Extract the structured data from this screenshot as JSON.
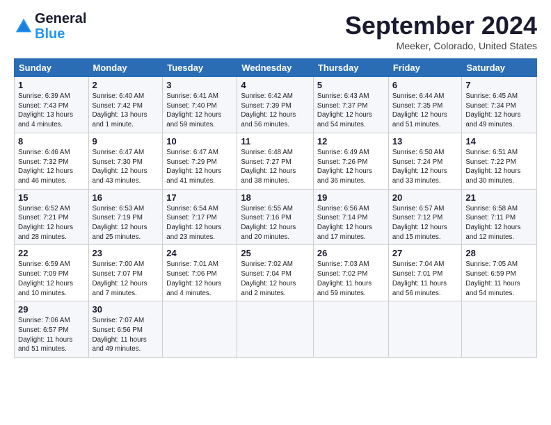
{
  "header": {
    "logo_line1": "General",
    "logo_line2": "Blue",
    "month": "September 2024",
    "location": "Meeker, Colorado, United States"
  },
  "weekdays": [
    "Sunday",
    "Monday",
    "Tuesday",
    "Wednesday",
    "Thursday",
    "Friday",
    "Saturday"
  ],
  "weeks": [
    [
      {
        "day": "1",
        "info": "Sunrise: 6:39 AM\nSunset: 7:43 PM\nDaylight: 13 hours\nand 4 minutes."
      },
      {
        "day": "2",
        "info": "Sunrise: 6:40 AM\nSunset: 7:42 PM\nDaylight: 13 hours\nand 1 minute."
      },
      {
        "day": "3",
        "info": "Sunrise: 6:41 AM\nSunset: 7:40 PM\nDaylight: 12 hours\nand 59 minutes."
      },
      {
        "day": "4",
        "info": "Sunrise: 6:42 AM\nSunset: 7:39 PM\nDaylight: 12 hours\nand 56 minutes."
      },
      {
        "day": "5",
        "info": "Sunrise: 6:43 AM\nSunset: 7:37 PM\nDaylight: 12 hours\nand 54 minutes."
      },
      {
        "day": "6",
        "info": "Sunrise: 6:44 AM\nSunset: 7:35 PM\nDaylight: 12 hours\nand 51 minutes."
      },
      {
        "day": "7",
        "info": "Sunrise: 6:45 AM\nSunset: 7:34 PM\nDaylight: 12 hours\nand 49 minutes."
      }
    ],
    [
      {
        "day": "8",
        "info": "Sunrise: 6:46 AM\nSunset: 7:32 PM\nDaylight: 12 hours\nand 46 minutes."
      },
      {
        "day": "9",
        "info": "Sunrise: 6:47 AM\nSunset: 7:30 PM\nDaylight: 12 hours\nand 43 minutes."
      },
      {
        "day": "10",
        "info": "Sunrise: 6:47 AM\nSunset: 7:29 PM\nDaylight: 12 hours\nand 41 minutes."
      },
      {
        "day": "11",
        "info": "Sunrise: 6:48 AM\nSunset: 7:27 PM\nDaylight: 12 hours\nand 38 minutes."
      },
      {
        "day": "12",
        "info": "Sunrise: 6:49 AM\nSunset: 7:26 PM\nDaylight: 12 hours\nand 36 minutes."
      },
      {
        "day": "13",
        "info": "Sunrise: 6:50 AM\nSunset: 7:24 PM\nDaylight: 12 hours\nand 33 minutes."
      },
      {
        "day": "14",
        "info": "Sunrise: 6:51 AM\nSunset: 7:22 PM\nDaylight: 12 hours\nand 30 minutes."
      }
    ],
    [
      {
        "day": "15",
        "info": "Sunrise: 6:52 AM\nSunset: 7:21 PM\nDaylight: 12 hours\nand 28 minutes."
      },
      {
        "day": "16",
        "info": "Sunrise: 6:53 AM\nSunset: 7:19 PM\nDaylight: 12 hours\nand 25 minutes."
      },
      {
        "day": "17",
        "info": "Sunrise: 6:54 AM\nSunset: 7:17 PM\nDaylight: 12 hours\nand 23 minutes."
      },
      {
        "day": "18",
        "info": "Sunrise: 6:55 AM\nSunset: 7:16 PM\nDaylight: 12 hours\nand 20 minutes."
      },
      {
        "day": "19",
        "info": "Sunrise: 6:56 AM\nSunset: 7:14 PM\nDaylight: 12 hours\nand 17 minutes."
      },
      {
        "day": "20",
        "info": "Sunrise: 6:57 AM\nSunset: 7:12 PM\nDaylight: 12 hours\nand 15 minutes."
      },
      {
        "day": "21",
        "info": "Sunrise: 6:58 AM\nSunset: 7:11 PM\nDaylight: 12 hours\nand 12 minutes."
      }
    ],
    [
      {
        "day": "22",
        "info": "Sunrise: 6:59 AM\nSunset: 7:09 PM\nDaylight: 12 hours\nand 10 minutes."
      },
      {
        "day": "23",
        "info": "Sunrise: 7:00 AM\nSunset: 7:07 PM\nDaylight: 12 hours\nand 7 minutes."
      },
      {
        "day": "24",
        "info": "Sunrise: 7:01 AM\nSunset: 7:06 PM\nDaylight: 12 hours\nand 4 minutes."
      },
      {
        "day": "25",
        "info": "Sunrise: 7:02 AM\nSunset: 7:04 PM\nDaylight: 12 hours\nand 2 minutes."
      },
      {
        "day": "26",
        "info": "Sunrise: 7:03 AM\nSunset: 7:02 PM\nDaylight: 11 hours\nand 59 minutes."
      },
      {
        "day": "27",
        "info": "Sunrise: 7:04 AM\nSunset: 7:01 PM\nDaylight: 11 hours\nand 56 minutes."
      },
      {
        "day": "28",
        "info": "Sunrise: 7:05 AM\nSunset: 6:59 PM\nDaylight: 11 hours\nand 54 minutes."
      }
    ],
    [
      {
        "day": "29",
        "info": "Sunrise: 7:06 AM\nSunset: 6:57 PM\nDaylight: 11 hours\nand 51 minutes."
      },
      {
        "day": "30",
        "info": "Sunrise: 7:07 AM\nSunset: 6:56 PM\nDaylight: 11 hours\nand 49 minutes."
      },
      {
        "day": "",
        "info": ""
      },
      {
        "day": "",
        "info": ""
      },
      {
        "day": "",
        "info": ""
      },
      {
        "day": "",
        "info": ""
      },
      {
        "day": "",
        "info": ""
      }
    ]
  ]
}
